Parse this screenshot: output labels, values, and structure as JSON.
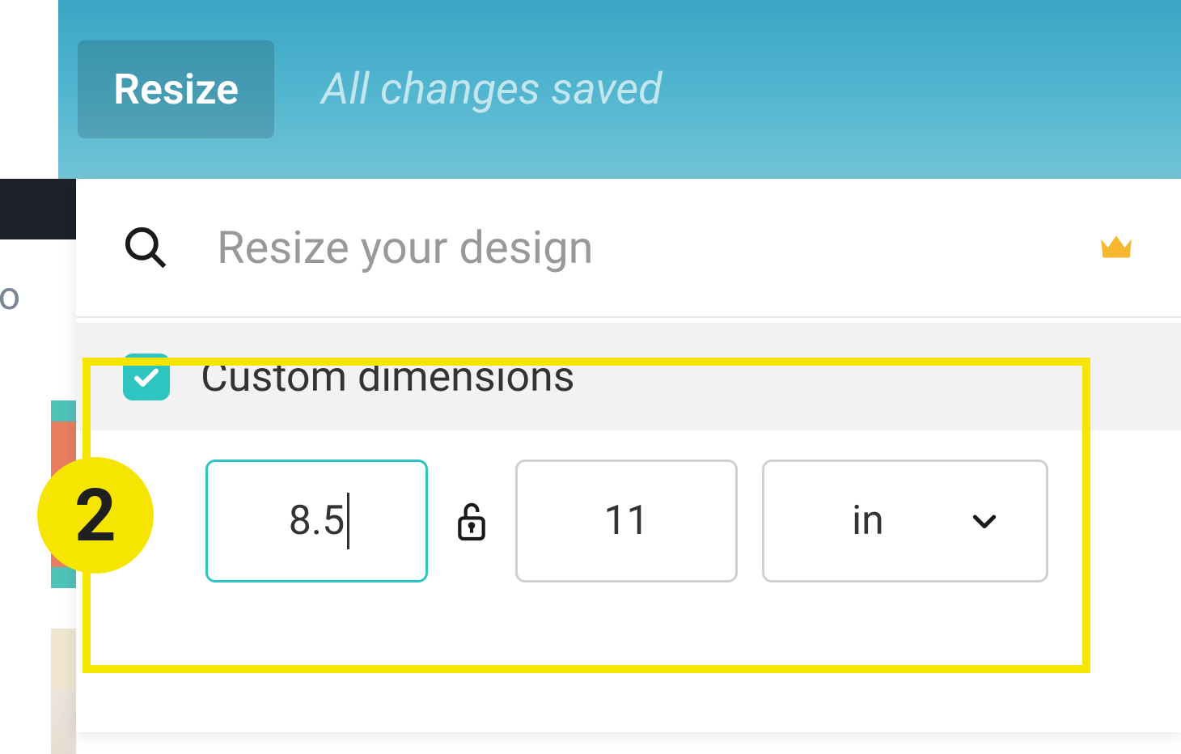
{
  "header": {
    "resize_label": "Resize",
    "saved_status": "All changes saved"
  },
  "dropdown": {
    "search_placeholder": "Resize your design",
    "custom_dimensions_label": "Custom dimensions",
    "width_value": "8.5",
    "height_value": "11",
    "unit_value": "in"
  },
  "annotation": {
    "step_number": "2"
  },
  "left_fragment": {
    "text": "ro"
  },
  "colors": {
    "accent_teal": "#2ec4c0",
    "highlight_yellow": "#f6e500",
    "crown_gold": "#f5b82e"
  }
}
